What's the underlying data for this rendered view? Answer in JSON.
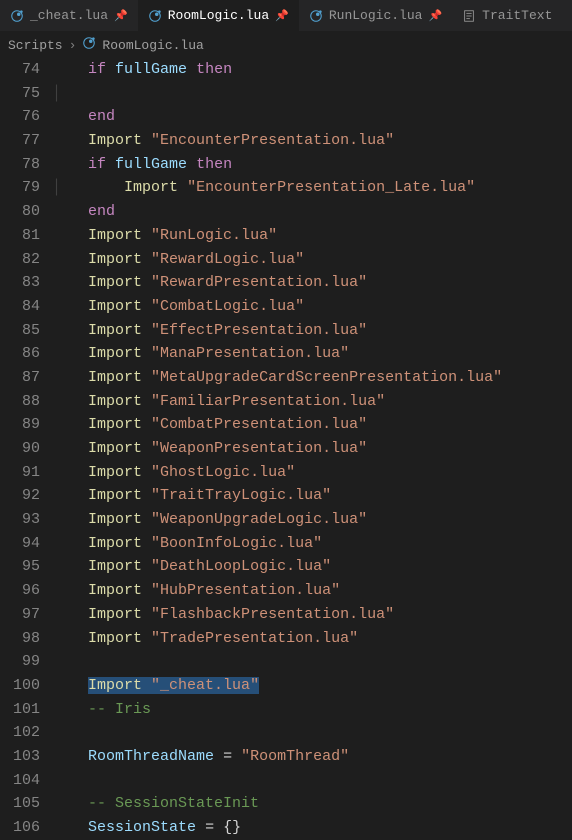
{
  "tabs": [
    {
      "icon": "lua",
      "label": "_cheat.lua",
      "pinned": true,
      "active": false
    },
    {
      "icon": "lua",
      "label": "RoomLogic.lua",
      "pinned": true,
      "active": true
    },
    {
      "icon": "lua",
      "label": "RunLogic.lua",
      "pinned": true,
      "active": false
    },
    {
      "icon": "lua",
      "label": "TraitText",
      "pinned": false,
      "active": false
    }
  ],
  "breadcrumb": {
    "segments": [
      "Scripts",
      "RoomLogic.lua"
    ],
    "icon": "lua"
  },
  "code_lines": [
    {
      "num": 74,
      "indent": 1,
      "tokens": [
        {
          "t": "kw",
          "v": "if"
        },
        {
          "t": "sp",
          "v": " "
        },
        {
          "t": "ident",
          "v": "fullGame"
        },
        {
          "t": "sp",
          "v": " "
        },
        {
          "t": "kw",
          "v": "then"
        }
      ]
    },
    {
      "num": 75,
      "indent": 1,
      "guide": true,
      "tokens": []
    },
    {
      "num": 76,
      "indent": 1,
      "tokens": [
        {
          "t": "kw",
          "v": "end"
        }
      ]
    },
    {
      "num": 77,
      "indent": 1,
      "tokens": [
        {
          "t": "fn",
          "v": "Import"
        },
        {
          "t": "sp",
          "v": " "
        },
        {
          "t": "str",
          "v": "\"EncounterPresentation.lua\""
        }
      ]
    },
    {
      "num": 78,
      "indent": 1,
      "tokens": [
        {
          "t": "kw",
          "v": "if"
        },
        {
          "t": "sp",
          "v": " "
        },
        {
          "t": "ident",
          "v": "fullGame"
        },
        {
          "t": "sp",
          "v": " "
        },
        {
          "t": "kw",
          "v": "then"
        }
      ]
    },
    {
      "num": 79,
      "indent": 1,
      "guide": true,
      "tokens": [
        {
          "t": "sp",
          "v": "    "
        },
        {
          "t": "fn",
          "v": "Import"
        },
        {
          "t": "sp",
          "v": " "
        },
        {
          "t": "str",
          "v": "\"EncounterPresentation_Late.lua\""
        }
      ]
    },
    {
      "num": 80,
      "indent": 1,
      "tokens": [
        {
          "t": "kw",
          "v": "end"
        }
      ]
    },
    {
      "num": 81,
      "indent": 1,
      "tokens": [
        {
          "t": "fn",
          "v": "Import"
        },
        {
          "t": "sp",
          "v": " "
        },
        {
          "t": "str",
          "v": "\"RunLogic.lua\""
        }
      ]
    },
    {
      "num": 82,
      "indent": 1,
      "tokens": [
        {
          "t": "fn",
          "v": "Import"
        },
        {
          "t": "sp",
          "v": " "
        },
        {
          "t": "str",
          "v": "\"RewardLogic.lua\""
        }
      ]
    },
    {
      "num": 83,
      "indent": 1,
      "tokens": [
        {
          "t": "fn",
          "v": "Import"
        },
        {
          "t": "sp",
          "v": " "
        },
        {
          "t": "str",
          "v": "\"RewardPresentation.lua\""
        }
      ]
    },
    {
      "num": 84,
      "indent": 1,
      "tokens": [
        {
          "t": "fn",
          "v": "Import"
        },
        {
          "t": "sp",
          "v": " "
        },
        {
          "t": "str",
          "v": "\"CombatLogic.lua\""
        }
      ]
    },
    {
      "num": 85,
      "indent": 1,
      "tokens": [
        {
          "t": "fn",
          "v": "Import"
        },
        {
          "t": "sp",
          "v": " "
        },
        {
          "t": "str",
          "v": "\"EffectPresentation.lua\""
        }
      ]
    },
    {
      "num": 86,
      "indent": 1,
      "tokens": [
        {
          "t": "fn",
          "v": "Import"
        },
        {
          "t": "sp",
          "v": " "
        },
        {
          "t": "str",
          "v": "\"ManaPresentation.lua\""
        }
      ]
    },
    {
      "num": 87,
      "indent": 1,
      "tokens": [
        {
          "t": "fn",
          "v": "Import"
        },
        {
          "t": "sp",
          "v": " "
        },
        {
          "t": "str",
          "v": "\"MetaUpgradeCardScreenPresentation.lua\""
        }
      ]
    },
    {
      "num": 88,
      "indent": 1,
      "tokens": [
        {
          "t": "fn",
          "v": "Import"
        },
        {
          "t": "sp",
          "v": " "
        },
        {
          "t": "str",
          "v": "\"FamiliarPresentation.lua\""
        }
      ]
    },
    {
      "num": 89,
      "indent": 1,
      "tokens": [
        {
          "t": "fn",
          "v": "Import"
        },
        {
          "t": "sp",
          "v": " "
        },
        {
          "t": "str",
          "v": "\"CombatPresentation.lua\""
        }
      ]
    },
    {
      "num": 90,
      "indent": 1,
      "tokens": [
        {
          "t": "fn",
          "v": "Import"
        },
        {
          "t": "sp",
          "v": " "
        },
        {
          "t": "str",
          "v": "\"WeaponPresentation.lua\""
        }
      ]
    },
    {
      "num": 91,
      "indent": 1,
      "tokens": [
        {
          "t": "fn",
          "v": "Import"
        },
        {
          "t": "sp",
          "v": " "
        },
        {
          "t": "str",
          "v": "\"GhostLogic.lua\""
        }
      ]
    },
    {
      "num": 92,
      "indent": 1,
      "tokens": [
        {
          "t": "fn",
          "v": "Import"
        },
        {
          "t": "sp",
          "v": " "
        },
        {
          "t": "str",
          "v": "\"TraitTrayLogic.lua\""
        }
      ]
    },
    {
      "num": 93,
      "indent": 1,
      "tokens": [
        {
          "t": "fn",
          "v": "Import"
        },
        {
          "t": "sp",
          "v": " "
        },
        {
          "t": "str",
          "v": "\"WeaponUpgradeLogic.lua\""
        }
      ]
    },
    {
      "num": 94,
      "indent": 1,
      "tokens": [
        {
          "t": "fn",
          "v": "Import"
        },
        {
          "t": "sp",
          "v": " "
        },
        {
          "t": "str",
          "v": "\"BoonInfoLogic.lua\""
        }
      ]
    },
    {
      "num": 95,
      "indent": 1,
      "tokens": [
        {
          "t": "fn",
          "v": "Import"
        },
        {
          "t": "sp",
          "v": " "
        },
        {
          "t": "str",
          "v": "\"DeathLoopLogic.lua\""
        }
      ]
    },
    {
      "num": 96,
      "indent": 1,
      "tokens": [
        {
          "t": "fn",
          "v": "Import"
        },
        {
          "t": "sp",
          "v": " "
        },
        {
          "t": "str",
          "v": "\"HubPresentation.lua\""
        }
      ]
    },
    {
      "num": 97,
      "indent": 1,
      "tokens": [
        {
          "t": "fn",
          "v": "Import"
        },
        {
          "t": "sp",
          "v": " "
        },
        {
          "t": "str",
          "v": "\"FlashbackPresentation.lua\""
        }
      ]
    },
    {
      "num": 98,
      "indent": 1,
      "tokens": [
        {
          "t": "fn",
          "v": "Import"
        },
        {
          "t": "sp",
          "v": " "
        },
        {
          "t": "str",
          "v": "\"TradePresentation.lua\""
        }
      ]
    },
    {
      "num": 99,
      "indent": 0,
      "tokens": []
    },
    {
      "num": 100,
      "indent": 1,
      "selected": true,
      "tokens": [
        {
          "t": "fn",
          "v": "Import"
        },
        {
          "t": "sp",
          "v": " "
        },
        {
          "t": "str",
          "v": "\"_cheat.lua\""
        }
      ]
    },
    {
      "num": 101,
      "indent": 1,
      "tokens": [
        {
          "t": "comment",
          "v": "-- Iris"
        }
      ]
    },
    {
      "num": 102,
      "indent": 0,
      "tokens": []
    },
    {
      "num": 103,
      "indent": 1,
      "tokens": [
        {
          "t": "ident",
          "v": "RoomThreadName"
        },
        {
          "t": "sp",
          "v": " "
        },
        {
          "t": "op",
          "v": "="
        },
        {
          "t": "sp",
          "v": " "
        },
        {
          "t": "str",
          "v": "\"RoomThread\""
        }
      ]
    },
    {
      "num": 104,
      "indent": 0,
      "tokens": []
    },
    {
      "num": 105,
      "indent": 1,
      "tokens": [
        {
          "t": "comment",
          "v": "-- SessionStateInit"
        }
      ]
    },
    {
      "num": 106,
      "indent": 1,
      "tokens": [
        {
          "t": "ident",
          "v": "SessionState"
        },
        {
          "t": "sp",
          "v": " "
        },
        {
          "t": "op",
          "v": "="
        },
        {
          "t": "sp",
          "v": " "
        },
        {
          "t": "op",
          "v": "{}"
        }
      ]
    }
  ]
}
